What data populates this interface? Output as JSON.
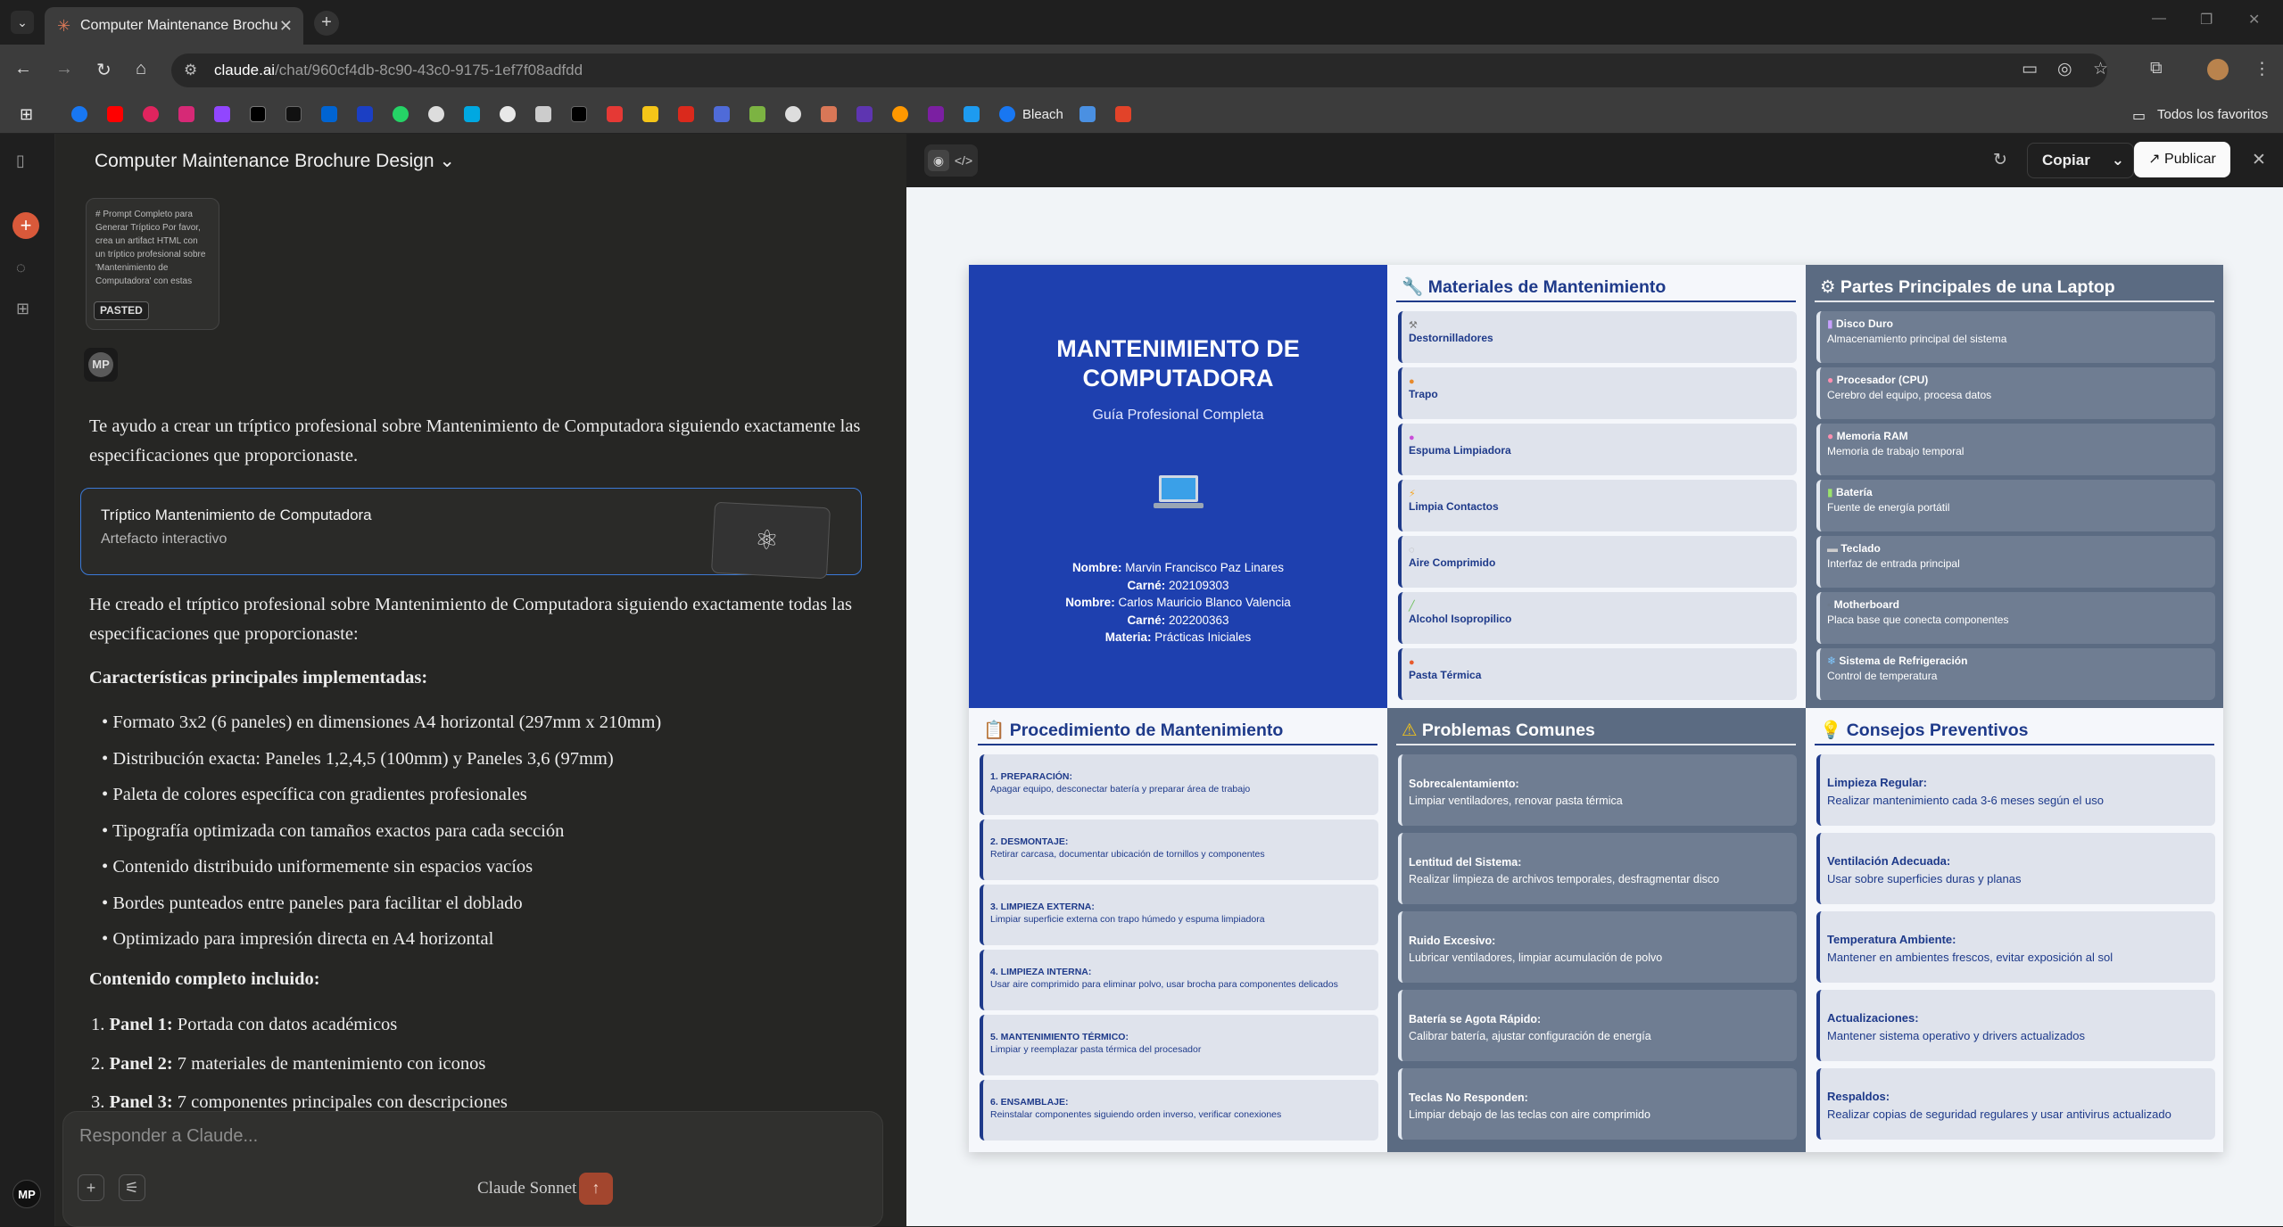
{
  "browser": {
    "tab_title": "Computer Maintenance Brochu",
    "url_host": "claude.ai",
    "url_path": "/chat/960cf4db-8c90-43c0-9175-1ef7f08adfdd",
    "bookmark_bleach": "Bleach",
    "bookmark_all": "Todos los favoritos"
  },
  "chat": {
    "title": "Computer Maintenance Brochure Design",
    "paste_preview": "# Prompt Completo para Generar Tríptico Por favor, crea un artifact HTML con un tríptico profesional sobre 'Mantenimiento de Computadora' con estas",
    "paste_badge": "PASTED",
    "user_initials": "MP",
    "msg1": "Te ayudo a crear un tríptico profesional sobre Mantenimiento de Computadora siguiendo exactamente las especificaciones que proporcionaste.",
    "artifact_title": "Tríptico Mantenimiento de Computadora",
    "artifact_sub": "Artefacto interactivo",
    "msg2": "He creado el tríptico profesional sobre Mantenimiento de Computadora siguiendo exactamente todas las especificaciones que proporcionaste:",
    "features_heading": "Características principales implementadas:",
    "features": [
      "Formato 3x2 (6 paneles) en dimensiones A4 horizontal (297mm x 210mm)",
      "Distribución exacta: Paneles 1,2,4,5 (100mm) y Paneles 3,6 (97mm)",
      "Paleta de colores específica con gradientes profesionales",
      "Tipografía optimizada con tamaños exactos para cada sección",
      "Contenido distribuido uniformemente sin espacios vacíos",
      "Bordes punteados entre paneles para facilitar el doblado",
      "Optimizado para impresión directa en A4 horizontal"
    ],
    "content_heading": "Contenido completo incluido:",
    "panels": [
      {
        "n": "1.",
        "label": "Panel 1:",
        "text": "Portada con datos académicos"
      },
      {
        "n": "2.",
        "label": "Panel 2:",
        "text": "7 materiales de mantenimiento con iconos"
      },
      {
        "n": "3.",
        "label": "Panel 3:",
        "text": "7 componentes principales con descripciones"
      }
    ],
    "input_placeholder": "Responder a Claude...",
    "model": "Claude Sonnet 4"
  },
  "pane": {
    "copy_label": "Copiar",
    "publish_label": "Publicar"
  },
  "brochure": {
    "cover": {
      "title": "MANTENIMIENTO DE COMPUTADORA",
      "subtitle": "Guía Profesional Completa",
      "rows": [
        {
          "k": "Nombre:",
          "v": "Marvin Francisco Paz Linares"
        },
        {
          "k": "Carné:",
          "v": "202109303"
        },
        {
          "k": "Nombre:",
          "v": "Carlos Mauricio Blanco Valencia"
        },
        {
          "k": "Carné:",
          "v": "202200363"
        },
        {
          "k": "Materia:",
          "v": "Prácticas Iniciales"
        }
      ]
    },
    "materials": {
      "title": "Materiales de Mantenimiento",
      "items": [
        "Destornilladores",
        "Trapo",
        "Espuma Limpiadora",
        "Limpia Contactos",
        "Aire Comprimido",
        "Alcohol Isopropilico",
        "Pasta Térmica"
      ]
    },
    "parts": {
      "title": "Partes Principales de una Laptop",
      "items": [
        {
          "name": "Disco Duro",
          "desc": "Almacenamiento principal del sistema"
        },
        {
          "name": "Procesador (CPU)",
          "desc": "Cerebro del equipo, procesa datos"
        },
        {
          "name": "Memoria RAM",
          "desc": "Memoria de trabajo temporal"
        },
        {
          "name": "Batería",
          "desc": "Fuente de energía portátil"
        },
        {
          "name": "Teclado",
          "desc": "Interfaz de entrada principal"
        },
        {
          "name": "Motherboard",
          "desc": "Placa base que conecta componentes"
        },
        {
          "name": "Sistema de Refrigeración",
          "desc": "Control de temperatura"
        }
      ]
    },
    "procedure": {
      "title": "Procedimiento de Mantenimiento",
      "items": [
        {
          "name": "1. PREPARACIÓN:",
          "desc": "Apagar equipo, desconectar batería y preparar área de trabajo"
        },
        {
          "name": "2. DESMONTAJE:",
          "desc": "Retirar carcasa, documentar ubicación de tornillos y componentes"
        },
        {
          "name": "3. LIMPIEZA EXTERNA:",
          "desc": "Limpiar superficie externa con trapo húmedo y espuma limpiadora"
        },
        {
          "name": "4. LIMPIEZA INTERNA:",
          "desc": "Usar aire comprimido para eliminar polvo, usar brocha para componentes delicados"
        },
        {
          "name": "5. MANTENIMIENTO TÉRMICO:",
          "desc": "Limpiar y reemplazar pasta térmica del procesador"
        },
        {
          "name": "6. ENSAMBLAJE:",
          "desc": "Reinstalar componentes siguiendo orden inverso, verificar conexiones"
        }
      ]
    },
    "problems": {
      "title": "Problemas Comunes",
      "items": [
        {
          "name": "Sobrecalentamiento:",
          "desc": "Limpiar ventiladores, renovar pasta térmica"
        },
        {
          "name": "Lentitud del Sistema:",
          "desc": "Realizar limpieza de archivos temporales, desfragmentar disco"
        },
        {
          "name": "Ruido Excesivo:",
          "desc": "Lubricar ventiladores, limpiar acumulación de polvo"
        },
        {
          "name": "Batería se Agota Rápido:",
          "desc": "Calibrar batería, ajustar configuración de energía"
        },
        {
          "name": "Teclas No Responden:",
          "desc": "Limpiar debajo de las teclas con aire comprimido"
        }
      ]
    },
    "tips": {
      "title": "Consejos Preventivos",
      "items": [
        {
          "name": "Limpieza Regular:",
          "desc": "Realizar mantenimiento cada 3-6 meses según el uso"
        },
        {
          "name": "Ventilación Adecuada:",
          "desc": "Usar sobre superficies duras y planas"
        },
        {
          "name": "Temperatura Ambiente:",
          "desc": "Mantener en ambientes frescos, evitar exposición al sol"
        },
        {
          "name": "Actualizaciones:",
          "desc": "Mantener sistema operativo y drivers actualizados"
        },
        {
          "name": "Respaldos:",
          "desc": "Realizar copias de seguridad regulares y usar antivirus actualizado"
        }
      ]
    }
  }
}
